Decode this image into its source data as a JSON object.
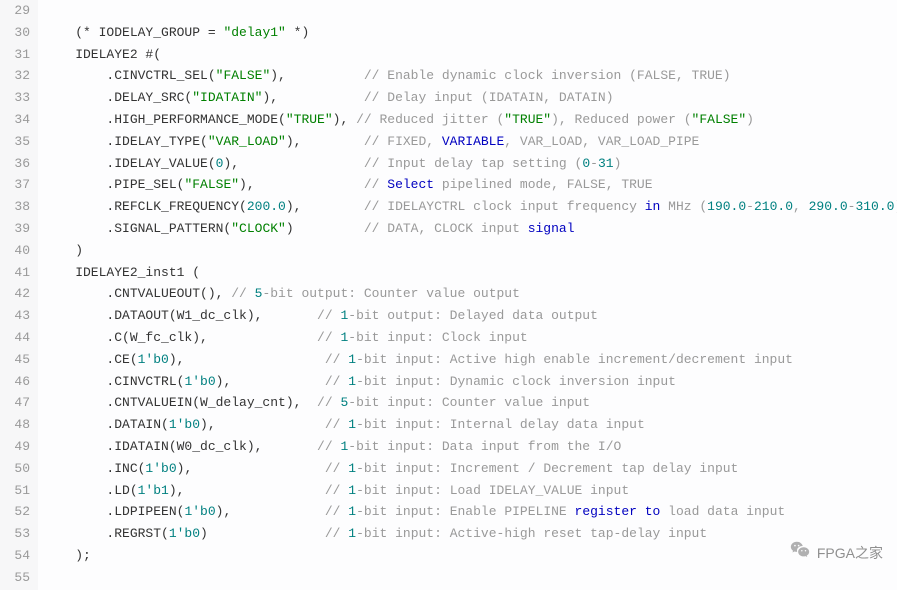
{
  "lineStart": 29,
  "lineEnd": 55,
  "lines": [
    [],
    [
      {
        "t": "plain",
        "v": "    (* IODELAY_GROUP = "
      },
      {
        "t": "string",
        "v": "\"delay1\""
      },
      {
        "t": "plain",
        "v": " *)"
      }
    ],
    [
      {
        "t": "plain",
        "v": "    IDELAYE2 #("
      }
    ],
    [
      {
        "t": "plain",
        "v": "        .CINVCTRL_SEL("
      },
      {
        "t": "string",
        "v": "\"FALSE\""
      },
      {
        "t": "plain",
        "v": "),          "
      },
      {
        "t": "comment",
        "v": "// Enable dynamic clock inversion (FALSE, TRUE)"
      }
    ],
    [
      {
        "t": "plain",
        "v": "        .DELAY_SRC("
      },
      {
        "t": "string",
        "v": "\"IDATAIN\""
      },
      {
        "t": "plain",
        "v": "),           "
      },
      {
        "t": "comment",
        "v": "// Delay input (IDATAIN, DATAIN)"
      }
    ],
    [
      {
        "t": "plain",
        "v": "        .HIGH_PERFORMANCE_MODE("
      },
      {
        "t": "string",
        "v": "\"TRUE\""
      },
      {
        "t": "plain",
        "v": "), "
      },
      {
        "t": "comment",
        "v": "// Reduced jitter ("
      },
      {
        "t": "string",
        "v": "\"TRUE\""
      },
      {
        "t": "comment",
        "v": "), Reduced power ("
      },
      {
        "t": "string",
        "v": "\"FALSE\""
      },
      {
        "t": "comment",
        "v": ")"
      }
    ],
    [
      {
        "t": "plain",
        "v": "        .IDELAY_TYPE("
      },
      {
        "t": "string",
        "v": "\"VAR_LOAD\""
      },
      {
        "t": "plain",
        "v": "),        "
      },
      {
        "t": "comment",
        "v": "// FIXED, "
      },
      {
        "t": "keyword",
        "v": "VARIABLE"
      },
      {
        "t": "comment",
        "v": ", VAR_LOAD, VAR_LOAD_PIPE"
      }
    ],
    [
      {
        "t": "plain",
        "v": "        .IDELAY_VALUE("
      },
      {
        "t": "number",
        "v": "0"
      },
      {
        "t": "plain",
        "v": "),                "
      },
      {
        "t": "comment",
        "v": "// Input delay tap setting ("
      },
      {
        "t": "number",
        "v": "0"
      },
      {
        "t": "comment",
        "v": "-"
      },
      {
        "t": "number",
        "v": "31"
      },
      {
        "t": "comment",
        "v": ")"
      }
    ],
    [
      {
        "t": "plain",
        "v": "        .PIPE_SEL("
      },
      {
        "t": "string",
        "v": "\"FALSE\""
      },
      {
        "t": "plain",
        "v": "),              "
      },
      {
        "t": "comment",
        "v": "// "
      },
      {
        "t": "keyword",
        "v": "Select"
      },
      {
        "t": "comment",
        "v": " pipelined mode, FALSE, TRUE"
      }
    ],
    [
      {
        "t": "plain",
        "v": "        .REFCLK_FREQUENCY("
      },
      {
        "t": "number",
        "v": "200.0"
      },
      {
        "t": "plain",
        "v": "),        "
      },
      {
        "t": "comment",
        "v": "// IDELAYCTRL clock input frequency "
      },
      {
        "t": "keyword",
        "v": "in"
      },
      {
        "t": "comment",
        "v": " MHz ("
      },
      {
        "t": "number",
        "v": "190.0"
      },
      {
        "t": "comment",
        "v": "-"
      },
      {
        "t": "number",
        "v": "210.0"
      },
      {
        "t": "comment",
        "v": ", "
      },
      {
        "t": "number",
        "v": "290.0"
      },
      {
        "t": "comment",
        "v": "-"
      },
      {
        "t": "number",
        "v": "310.0"
      },
      {
        "t": "comment",
        "v": ")."
      }
    ],
    [
      {
        "t": "plain",
        "v": "        .SIGNAL_PATTERN("
      },
      {
        "t": "string",
        "v": "\"CLOCK\""
      },
      {
        "t": "plain",
        "v": ")         "
      },
      {
        "t": "comment",
        "v": "// DATA, CLOCK input "
      },
      {
        "t": "keyword",
        "v": "signal"
      }
    ],
    [
      {
        "t": "plain",
        "v": "    )"
      }
    ],
    [
      {
        "t": "plain",
        "v": "    IDELAYE2_inst1 ("
      }
    ],
    [
      {
        "t": "plain",
        "v": "        .CNTVALUEOUT(), "
      },
      {
        "t": "comment",
        "v": "// "
      },
      {
        "t": "number",
        "v": "5"
      },
      {
        "t": "comment",
        "v": "-bit output: Counter value output"
      }
    ],
    [
      {
        "t": "plain",
        "v": "        .DATAOUT(W1_dc_clk),       "
      },
      {
        "t": "comment",
        "v": "// "
      },
      {
        "t": "number",
        "v": "1"
      },
      {
        "t": "comment",
        "v": "-bit output: Delayed data output"
      }
    ],
    [
      {
        "t": "plain",
        "v": "        .C(W_fc_clk),              "
      },
      {
        "t": "comment",
        "v": "// "
      },
      {
        "t": "number",
        "v": "1"
      },
      {
        "t": "comment",
        "v": "-bit input: Clock input"
      }
    ],
    [
      {
        "t": "plain",
        "v": "        .CE("
      },
      {
        "t": "number",
        "v": "1'b0"
      },
      {
        "t": "plain",
        "v": "),                  "
      },
      {
        "t": "comment",
        "v": "// "
      },
      {
        "t": "number",
        "v": "1"
      },
      {
        "t": "comment",
        "v": "-bit input: Active high enable increment/decrement input"
      }
    ],
    [
      {
        "t": "plain",
        "v": "        .CINVCTRL("
      },
      {
        "t": "number",
        "v": "1'b0"
      },
      {
        "t": "plain",
        "v": "),            "
      },
      {
        "t": "comment",
        "v": "// "
      },
      {
        "t": "number",
        "v": "1"
      },
      {
        "t": "comment",
        "v": "-bit input: Dynamic clock inversion input"
      }
    ],
    [
      {
        "t": "plain",
        "v": "        .CNTVALUEIN(W_delay_cnt),  "
      },
      {
        "t": "comment",
        "v": "// "
      },
      {
        "t": "number",
        "v": "5"
      },
      {
        "t": "comment",
        "v": "-bit input: Counter value input"
      }
    ],
    [
      {
        "t": "plain",
        "v": "        .DATAIN("
      },
      {
        "t": "number",
        "v": "1'b0"
      },
      {
        "t": "plain",
        "v": "),              "
      },
      {
        "t": "comment",
        "v": "// "
      },
      {
        "t": "number",
        "v": "1"
      },
      {
        "t": "comment",
        "v": "-bit input: Internal delay data input"
      }
    ],
    [
      {
        "t": "plain",
        "v": "        .IDATAIN(W0_dc_clk),       "
      },
      {
        "t": "comment",
        "v": "// "
      },
      {
        "t": "number",
        "v": "1"
      },
      {
        "t": "comment",
        "v": "-bit input: Data input from the I/O"
      }
    ],
    [
      {
        "t": "plain",
        "v": "        .INC("
      },
      {
        "t": "number",
        "v": "1'b0"
      },
      {
        "t": "plain",
        "v": "),                 "
      },
      {
        "t": "comment",
        "v": "// "
      },
      {
        "t": "number",
        "v": "1"
      },
      {
        "t": "comment",
        "v": "-bit input: Increment / Decrement tap delay input"
      }
    ],
    [
      {
        "t": "plain",
        "v": "        .LD("
      },
      {
        "t": "number",
        "v": "1'b1"
      },
      {
        "t": "plain",
        "v": "),                  "
      },
      {
        "t": "comment",
        "v": "// "
      },
      {
        "t": "number",
        "v": "1"
      },
      {
        "t": "comment",
        "v": "-bit input: Load IDELAY_VALUE input"
      }
    ],
    [
      {
        "t": "plain",
        "v": "        .LDPIPEEN("
      },
      {
        "t": "number",
        "v": "1'b0"
      },
      {
        "t": "plain",
        "v": "),            "
      },
      {
        "t": "comment",
        "v": "// "
      },
      {
        "t": "number",
        "v": "1"
      },
      {
        "t": "comment",
        "v": "-bit input: Enable PIPELINE "
      },
      {
        "t": "keyword",
        "v": "register to"
      },
      {
        "t": "comment",
        "v": " load data input"
      }
    ],
    [
      {
        "t": "plain",
        "v": "        .REGRST("
      },
      {
        "t": "number",
        "v": "1'b0"
      },
      {
        "t": "plain",
        "v": ")               "
      },
      {
        "t": "comment",
        "v": "// "
      },
      {
        "t": "number",
        "v": "1"
      },
      {
        "t": "comment",
        "v": "-bit input: Active-high reset tap-delay input"
      }
    ],
    [
      {
        "t": "plain",
        "v": "    );"
      }
    ],
    []
  ],
  "watermark": {
    "label": "FPGA之家"
  }
}
